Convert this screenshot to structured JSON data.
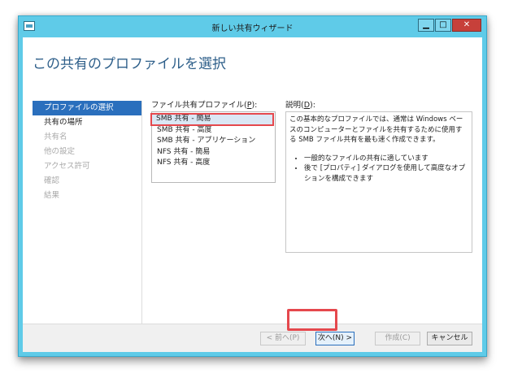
{
  "window": {
    "title": "新しい共有ウィザード",
    "buttons": {
      "minimize": "▁",
      "maximize": "□",
      "close": "✕"
    }
  },
  "page": {
    "heading": "この共有のプロファイルを選択"
  },
  "nav": {
    "items": [
      {
        "label": "プロファイルの選択",
        "state": "active"
      },
      {
        "label": "共有の場所",
        "state": "enabled"
      },
      {
        "label": "共有名",
        "state": "disabled"
      },
      {
        "label": "他の設定",
        "state": "disabled"
      },
      {
        "label": "アクセス許可",
        "state": "disabled"
      },
      {
        "label": "確認",
        "state": "disabled"
      },
      {
        "label": "結果",
        "state": "disabled"
      }
    ]
  },
  "profile": {
    "label_prefix": "ファイル共有プロファイル(",
    "label_accel": "P",
    "label_suffix": "):",
    "options": [
      "SMB 共有 - 簡易",
      "SMB 共有 - 高度",
      "SMB 共有 - アプリケーション",
      "NFS 共有 - 簡易",
      "NFS 共有 - 高度"
    ],
    "selected": "SMB 共有 - 簡易"
  },
  "description": {
    "label_prefix": "説明(",
    "label_accel": "D",
    "label_suffix": "):",
    "text": "この基本的なプロファイルでは、通常は Windows ベースのコンピューターとファイルを共有するために使用する SMB ファイル共有を最も速く作成できます。",
    "bullets": [
      "一般的なファイルの共有に適しています",
      "後で [プロパティ] ダイアログを使用して高度なオプションを構成できます"
    ]
  },
  "footer": {
    "prev": "< 前へ(P)",
    "next": "次へ(N) >",
    "create": "作成(C)",
    "cancel": "キャンセル"
  },
  "colors": {
    "accent": "#2a6fbd",
    "titlebar": "#5fcbe8",
    "highlight": "#e5484d"
  }
}
